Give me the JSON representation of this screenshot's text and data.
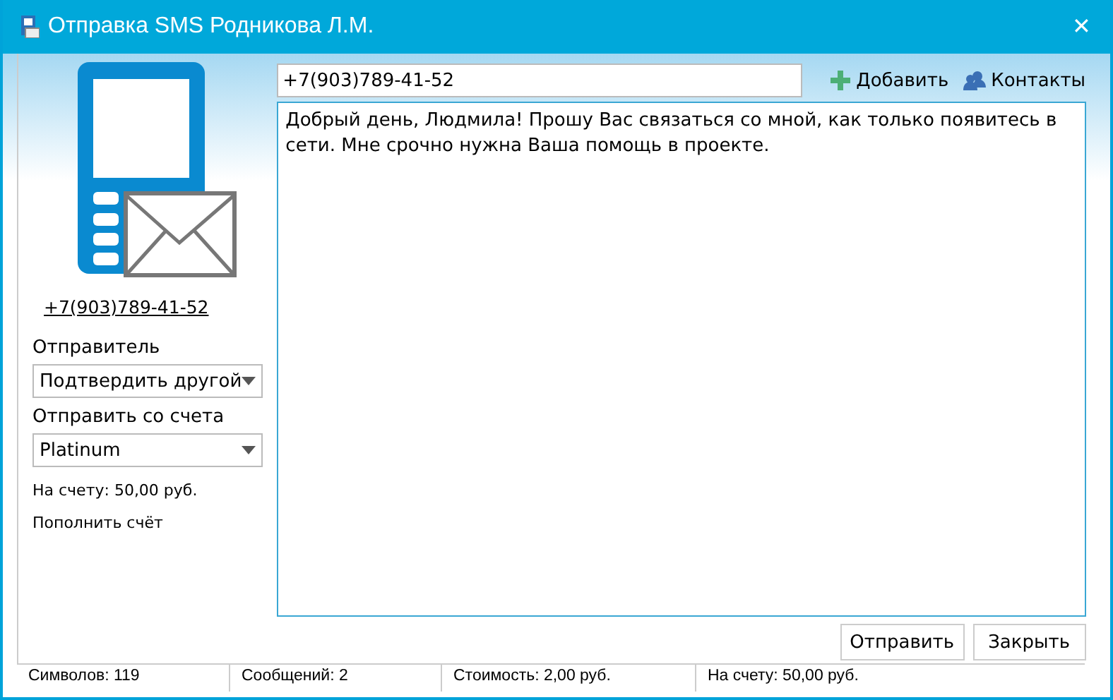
{
  "window": {
    "title": "Отправка SMS Родникова Л.М.",
    "close": "✕"
  },
  "sidebar": {
    "phone_link": "+7(903)789-41-52",
    "sender_label": "Отправитель",
    "sender_value": "Подтвердить другой",
    "account_label": "Отправить со счета",
    "account_value": "Platinum",
    "balance": "На счету: 50,00 руб.",
    "top_up": "Пополнить счёт"
  },
  "recipient": {
    "value": "+7(903)789-41-52"
  },
  "toolbar": [
    {
      "kind": "add",
      "label": "Добавить"
    },
    {
      "kind": "contacts",
      "label": "Контакты"
    }
  ],
  "message": {
    "value": "Добрый день, Людмила! Прошу Вас связаться со мной, как только появитесь в сети. Мне срочно нужна Ваша помощь в проекте."
  },
  "buttons": [
    "Отправить",
    "Закрыть"
  ],
  "status_bar": [
    {
      "text": "Символов: 119"
    },
    {
      "text": "Сообщений: 2"
    },
    {
      "text": "Стоимость: 2,00 руб."
    },
    {
      "text": "На счету: 50,00 руб."
    }
  ]
}
